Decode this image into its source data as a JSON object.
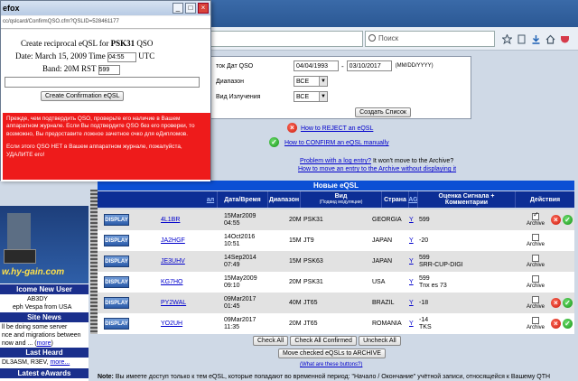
{
  "browser": {
    "title": "efox",
    "search_placeholder": "Поиск"
  },
  "popup": {
    "url": "cc/qslcard/ConfirmQSO.cfm?QSLID=528461177",
    "heading_prefix": "Create reciprocal eQSL for",
    "heading_mode": "PSK31",
    "heading_suffix": "QSO",
    "date_label": "Date: March 15, 2009 Time",
    "time_value": "04:55",
    "utc_label": "UTC",
    "band_label": "Band: 20M RST",
    "rst_value": "599",
    "confirm_button": "Create Confirmation eQSL",
    "warning_1": "Прежде, чем подтвердить QSO, проверьте его наличие в Вашем аппаратном журнале. Если Вы подтвердите QSO без его проверки, то возможно, Вы предоставите ложное зачетное очко для eДипломов.",
    "warning_2": "Если этого QSO НЕТ в Вашем аппаратном журнале, пожалуйста, УДАЛИТЕ его!"
  },
  "filters": {
    "date_label": "ток Дат QSO",
    "date_from": "04/04/1993",
    "date_sep": "-",
    "date_to": "03/10/2017",
    "date_format": "(MM/DD/YYYY)",
    "band_label": "Диапазон",
    "band_value": "ВСЕ",
    "mode_label": "Вид Излучения",
    "mode_value": "ВСЕ",
    "create_list_button": "Создать Список"
  },
  "links": {
    "reject": "How to REJECT an eQSL",
    "confirm": "How to CONFIRM an eQSL manually",
    "problem": "Problem with a log entry?",
    "problem_tail": "It won't move to the Archive?",
    "move": "How to move an entry to the Archive without displaying it"
  },
  "sidebar": {
    "brand": "w.hy-gain.com",
    "welcome_head": "lcome New User",
    "welcome_call": "AB3DY",
    "welcome_name": "eph Vespa from USA",
    "news_head": "Site News",
    "news_1": "ll be doing some server",
    "news_2": "nce and migrations between",
    "news_3": "now and ...",
    "news_more": "more",
    "heard_head": "Last Heard",
    "heard_text": "DL3ASM, R3EV,",
    "heard_more": "more...",
    "awards_head": "Latest eAwards"
  },
  "table": {
    "title": "Новые eQSL",
    "headers": {
      "call": "ал",
      "datetime": "Дата/Время",
      "band": "Диапазон",
      "mode": "Вид",
      "mode_sub": "(Подвид модуляции)",
      "country": "Страна",
      "ag": "AG",
      "rst": "Оценка Сигнала + Комментарии",
      "actions": "Действия"
    },
    "display_label": "DISPLAY",
    "archive_label": "Archive",
    "rows": [
      {
        "call": "4L1BR",
        "date": "15Mar2009",
        "time": "04:55",
        "band": "20M",
        "mode": "PSK31",
        "country": "GEORGIA",
        "ag": "Y",
        "rst": "599",
        "rst2": "",
        "checked": true,
        "reject": true,
        "confirm": true
      },
      {
        "call": "JA2HGF",
        "date": "14Oct2016",
        "time": "10:51",
        "band": "15M",
        "mode": "JT9",
        "country": "JAPAN",
        "ag": "Y",
        "rst": "-20",
        "rst2": "",
        "checked": false,
        "reject": false,
        "confirm": false
      },
      {
        "call": "JE3UHV",
        "date": "14Sep2014",
        "time": "07:49",
        "band": "15M",
        "mode": "PSK63",
        "country": "JAPAN",
        "ag": "Y",
        "rst": "599",
        "rst2": "SRR-CUP-DIGI",
        "checked": false,
        "reject": false,
        "confirm": false
      },
      {
        "call": "KG7HO",
        "date": "15May2009",
        "time": "09:10",
        "band": "20M",
        "mode": "PSK31",
        "country": "USA",
        "ag": "Y",
        "rst": "599",
        "rst2": "Tnx es 73",
        "checked": false,
        "reject": false,
        "confirm": false
      },
      {
        "call": "PY2WAL",
        "date": "09Mar2017",
        "time": "01:45",
        "band": "40M",
        "mode": "JT65",
        "country": "BRAZIL",
        "ag": "Y",
        "rst": "-18",
        "rst2": "",
        "checked": false,
        "reject": true,
        "confirm": true
      },
      {
        "call": "YO2UH",
        "date": "09Mar2017",
        "time": "11:35",
        "band": "20M",
        "mode": "JT65",
        "country": "ROMANIA",
        "ag": "Y",
        "rst": "-14",
        "rst2": "TKS",
        "checked": false,
        "reject": true,
        "confirm": true
      }
    ]
  },
  "bottom": {
    "check_all": "Check All",
    "check_all_confirmed": "Check All Confirmed",
    "uncheck_all": "Uncheck All",
    "move_archive": "Move checked eQSLs to ARCHIVE",
    "what_is_this": "(What are these buttons?)",
    "note_bold": "Note:",
    "note_text": "Вы имеете доступ только к тем eQSL, которые попадают во временной период: \"Начало / Окончание\" учётной записи, относящейся к Вашему QTH"
  }
}
